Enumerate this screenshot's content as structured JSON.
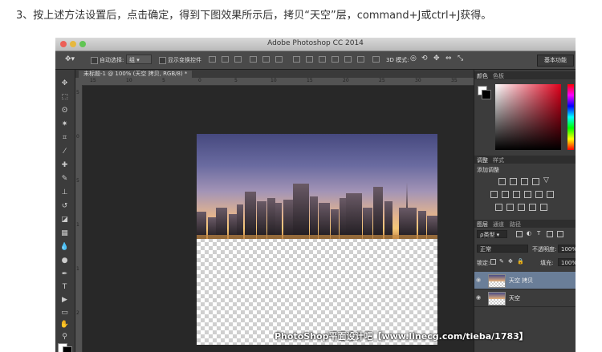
{
  "caption": "3、按上述方法设置后，点击确定，得到下图效果所示后，拷贝“天空”层，command+J或ctrl+J获得。",
  "app": {
    "title": "Adobe Photoshop CC 2014",
    "workspace": "基本功能"
  },
  "options_bar": {
    "auto_select_label": "自动选择:",
    "auto_select_value": "组",
    "show_transform_label": "显示变换控件",
    "mode_3d_label": "3D 模式:"
  },
  "document": {
    "tab_label": "未标题-1 @ 100% (天空 拷贝, RGB/8) *",
    "ruler_top_ticks": [
      "15",
      "10",
      "5",
      "0",
      "5",
      "10",
      "15",
      "20",
      "25",
      "30",
      "35"
    ],
    "ruler_left_ticks": [
      "5",
      "0",
      "5",
      "1",
      "1",
      "2"
    ]
  },
  "panels": {
    "color_tab": "颜色",
    "swatches_tab": "色板",
    "adjustments_tab": "调整",
    "styles_tab": "样式",
    "add_adjustment_label": "添加调整",
    "layers_tab": "图层",
    "channels_tab": "通道",
    "paths_tab": "路径",
    "filter_kind": "ρ类型",
    "blend_mode": "正常",
    "opacity_label": "不透明度:",
    "opacity_value": "100%",
    "lock_label": "锁定:",
    "fill_label": "填充:",
    "fill_value": "100%"
  },
  "layers": [
    {
      "name": "天空 拷贝",
      "selected": true
    },
    {
      "name": "天空",
      "selected": false
    }
  ],
  "watermark": "PhotoShop平面设计吧【www.linecg.com/tieba/1783】",
  "colors": {
    "selected_layer": "#6a7e98",
    "app_bg": "#2b2b2b",
    "picker_hue": "#e0001b"
  }
}
